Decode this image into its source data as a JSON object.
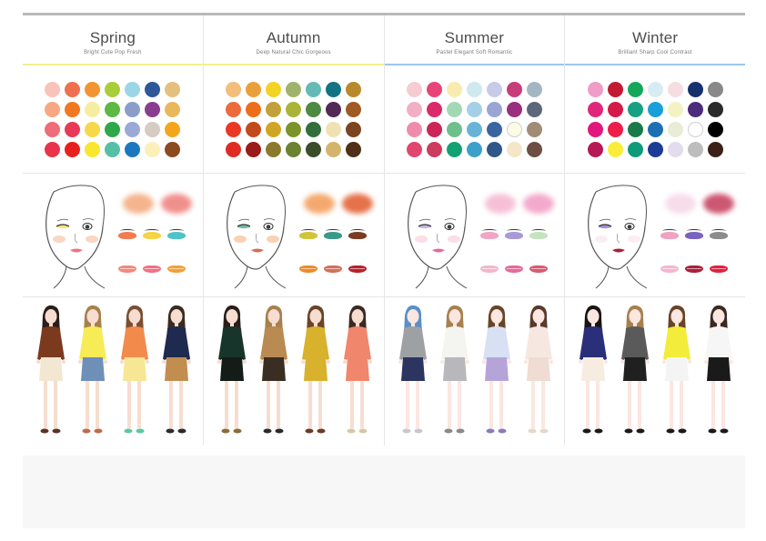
{
  "seasons": [
    {
      "name": "Spring",
      "subtitle": "Bright  Cute  Pop  Fresh",
      "accent": "#f3ef8a",
      "swatches": [
        "#f8c3b8",
        "#ef7050",
        "#f39432",
        "#aacd3a",
        "#9ad6e6",
        "#2d5899",
        "#e3c07e",
        "#f7a782",
        "#f07820",
        "#f5eea0",
        "#5db844",
        "#8b9ec9",
        "#8a3d8f",
        "#e8b85c",
        "#ee6d78",
        "#e83a58",
        "#f6d84a",
        "#2fa84a",
        "#9aa9d8",
        "#d6ccc2",
        "#f3a61c",
        "#e8344a",
        "#e8201c",
        "#f9e62e",
        "#56c0a6",
        "#1c77bf",
        "#fbefba",
        "#8c4b1e"
      ],
      "blush": [
        "#f3a779",
        "#ee7d7a"
      ],
      "eyes": [
        "#f27c52",
        "#f5d545",
        "#4ec4c8"
      ],
      "lips": [
        "#f08a7c",
        "#ef7184",
        "#f4a035"
      ],
      "skin": "#f7ddd0",
      "outfits": [
        {
          "top": "#7b3a1e",
          "bottom": "#f3e7d2",
          "shoes": "#5a3320",
          "hair": "#2a1e1a"
        },
        {
          "top": "#f7ec55",
          "bottom": "#6d8fb8",
          "shoes": "#c0694a",
          "hair": "#a7804e"
        },
        {
          "top": "#f28a4c",
          "bottom": "#f7e694",
          "shoes": "#5dc6a5",
          "hair": "#7a4e32"
        },
        {
          "top": "#1f2a4f",
          "bottom": "#c28e50",
          "shoes": "#2a2a2a",
          "hair": "#3a2a22"
        }
      ]
    },
    {
      "name": "Autumn",
      "subtitle": "Deep  Natural  Chic  Gorgeous",
      "accent": "#f3ef8a",
      "swatches": [
        "#f3bd7a",
        "#eaa03a",
        "#f3d323",
        "#9fb36b",
        "#65b9b6",
        "#127383",
        "#b88a2c",
        "#ec6a3c",
        "#ec6e1a",
        "#c2a03a",
        "#a9b438",
        "#4e8a42",
        "#522a55",
        "#9f5a26",
        "#ea3824",
        "#c24a1c",
        "#d1a524",
        "#7b9329",
        "#336f3b",
        "#f0e1b2",
        "#7c4420",
        "#df2b24",
        "#9b1a1a",
        "#8b7a2d",
        "#6a8232",
        "#3a4d2a",
        "#d4b46a",
        "#4f3016"
      ],
      "blush": [
        "#f39a55",
        "#e15a2a"
      ],
      "eyes": [
        "#d2c43a",
        "#3a9a8a",
        "#7a3c22"
      ],
      "lips": [
        "#ec8a2a",
        "#d2705a",
        "#b9202a"
      ],
      "skin": "#f7ddd0",
      "outfits": [
        {
          "top": "#18352b",
          "bottom": "#141c18",
          "shoes": "#8b6b3a",
          "hair": "#2a1e1a"
        },
        {
          "top": "#b98a52",
          "bottom": "#3a2e22",
          "shoes": "#2a2a2a",
          "hair": "#a7804e"
        },
        {
          "top": "#d8b12d",
          "bottom": "#d8b12d",
          "shoes": "#6b3a22",
          "hair": "#6a4428"
        },
        {
          "top": "#f0866c",
          "bottom": "#f0866c",
          "shoes": "#d8c6a6",
          "hair": "#3a2a22"
        }
      ]
    },
    {
      "name": "Summer",
      "subtitle": "Pastel  Elegant  Soft  Romantic",
      "accent": "#9cc6ee",
      "swatches": [
        "#f6ccd2",
        "#e8447a",
        "#f7ecae",
        "#cfe9ee",
        "#c7cbe7",
        "#c63d7a",
        "#a5b6c3",
        "#f1aec5",
        "#db2a6a",
        "#a3d8b5",
        "#a4cfe7",
        "#9aa5d6",
        "#9a2f7e",
        "#5c6879",
        "#ef8cac",
        "#cc2557",
        "#6ebf8c",
        "#67b4d8",
        "#3a65a0",
        "#fdfbe6",
        "#a18c76",
        "#e0466e",
        "#cc3c5e",
        "#13a072",
        "#3da0c8",
        "#31568a",
        "#f4e6c6",
        "#6e4d42"
      ],
      "blush": [
        "#f4b6cf",
        "#f29bc3"
      ],
      "eyes": [
        "#f0a6c6",
        "#a79ad6",
        "#c6e3c0"
      ],
      "lips": [
        "#f2b6cc",
        "#e56a9a",
        "#d85a72"
      ],
      "skin": "#fbe6e0",
      "outfits": [
        {
          "top": "#9ea1a4",
          "bottom": "#2b3560",
          "shoes": "#c8c8d0",
          "hair": "#5a8fc7"
        },
        {
          "top": "#f4f4f0",
          "bottom": "#b8b8bc",
          "shoes": "#8a8a8a",
          "hair": "#a7804e"
        },
        {
          "top": "#d8e0f4",
          "bottom": "#b6a4d8",
          "shoes": "#8c7bb8",
          "hair": "#6a4428"
        },
        {
          "top": "#f6e8e0",
          "bottom": "#f0dcd2",
          "shoes": "#e8d6c8",
          "hair": "#5a3a2a"
        }
      ]
    },
    {
      "name": "Winter",
      "subtitle": "Brilliant  Sharp  Cool  Contrast",
      "accent": "#9cc6ee",
      "swatches": [
        "#ef9cc6",
        "#c21a33",
        "#16a85a",
        "#d6ecf2",
        "#f6dde2",
        "#17306e",
        "#898989",
        "#e0287a",
        "#d51a4a",
        "#18a082",
        "#1b9fd8",
        "#f3f2c2",
        "#4c2c7a",
        "#2a2a2a",
        "#e3167e",
        "#ed1c4a",
        "#187a4a",
        "#1c6fb3",
        "#e9ecd6",
        "#ffffff",
        "#000000",
        "#b51a56",
        "#f9ed3a",
        "#0f9a7a",
        "#1c3c96",
        "#e3dbee",
        "#bdbdbd",
        "#3c1f16"
      ],
      "blush": [
        "#f6d6e6",
        "#c43a5a"
      ],
      "eyes": [
        "#f0a2c0",
        "#7a62c0",
        "#8c8c8c"
      ],
      "lips": [
        "#f3b6cf",
        "#a8203a",
        "#e0203e"
      ],
      "skin": "#fbe6e0",
      "outfits": [
        {
          "top": "#2a2f7a",
          "bottom": "#f6ede0",
          "shoes": "#1a1a1a",
          "hair": "#1a1410"
        },
        {
          "top": "#5a5a5a",
          "bottom": "#202020",
          "shoes": "#1a1a1a",
          "hair": "#a7804e"
        },
        {
          "top": "#f3ec3a",
          "bottom": "#f4f4f4",
          "shoes": "#1a1a1a",
          "hair": "#6a4428"
        },
        {
          "top": "#f6f6f6",
          "bottom": "#1a1a1a",
          "shoes": "#1a1a1a",
          "hair": "#3a2a22"
        }
      ]
    }
  ]
}
